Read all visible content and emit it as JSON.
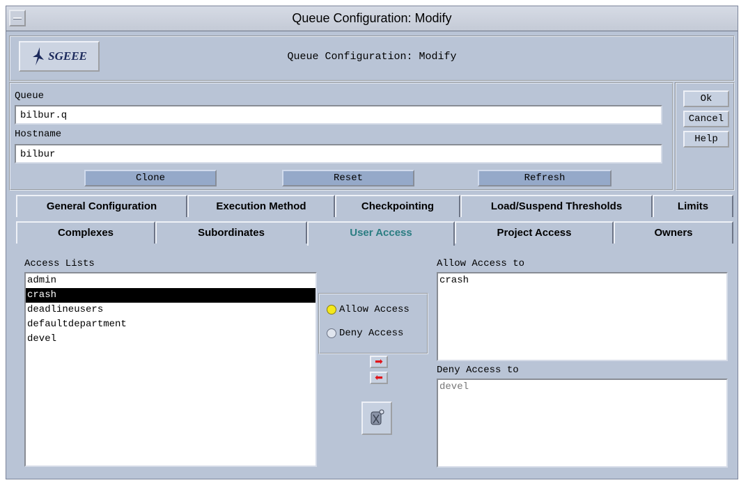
{
  "window": {
    "title": "Queue Configuration: Modify"
  },
  "header": {
    "logo_text": "SGEEE",
    "title": "Queue Configuration: Modify"
  },
  "form": {
    "queue_label": "Queue",
    "queue_value": "bilbur.q",
    "hostname_label": "Hostname",
    "hostname_value": "bilbur",
    "clone_label": "Clone",
    "reset_label": "Reset",
    "refresh_label": "Refresh"
  },
  "side_buttons": {
    "ok": "Ok",
    "cancel": "Cancel",
    "help": "Help"
  },
  "tabs_row1": [
    "General Configuration",
    "Execution Method",
    "Checkpointing",
    "Load/Suspend Thresholds",
    "Limits"
  ],
  "tabs_row2": [
    "Complexes",
    "Subordinates",
    "User Access",
    "Project Access",
    "Owners"
  ],
  "active_tab": "User Access",
  "access_lists": {
    "label": "Access Lists",
    "items": [
      "admin",
      "crash",
      "deadlineusers",
      "defaultdepartment",
      "devel"
    ],
    "selected": "crash"
  },
  "mode": {
    "allow_label": "Allow Access",
    "deny_label": "Deny Access",
    "selected": "Allow Access"
  },
  "allow_access": {
    "label": "Allow Access to",
    "items": [
      "crash"
    ]
  },
  "deny_access": {
    "label": "Deny Access to",
    "items": [
      "devel"
    ]
  },
  "colors": {
    "window_bg": "#b9c4d6",
    "button_bg": "#95a9c9",
    "active_tab_text": "#2b7d82",
    "radio_on": "#f4e81c",
    "arrow": "#e0141a"
  },
  "icons": {
    "move_right": "red-arrow-right-icon",
    "move_left": "red-arrow-left-icon",
    "clear": "broom-icon",
    "logo": "sge-bird-icon"
  }
}
